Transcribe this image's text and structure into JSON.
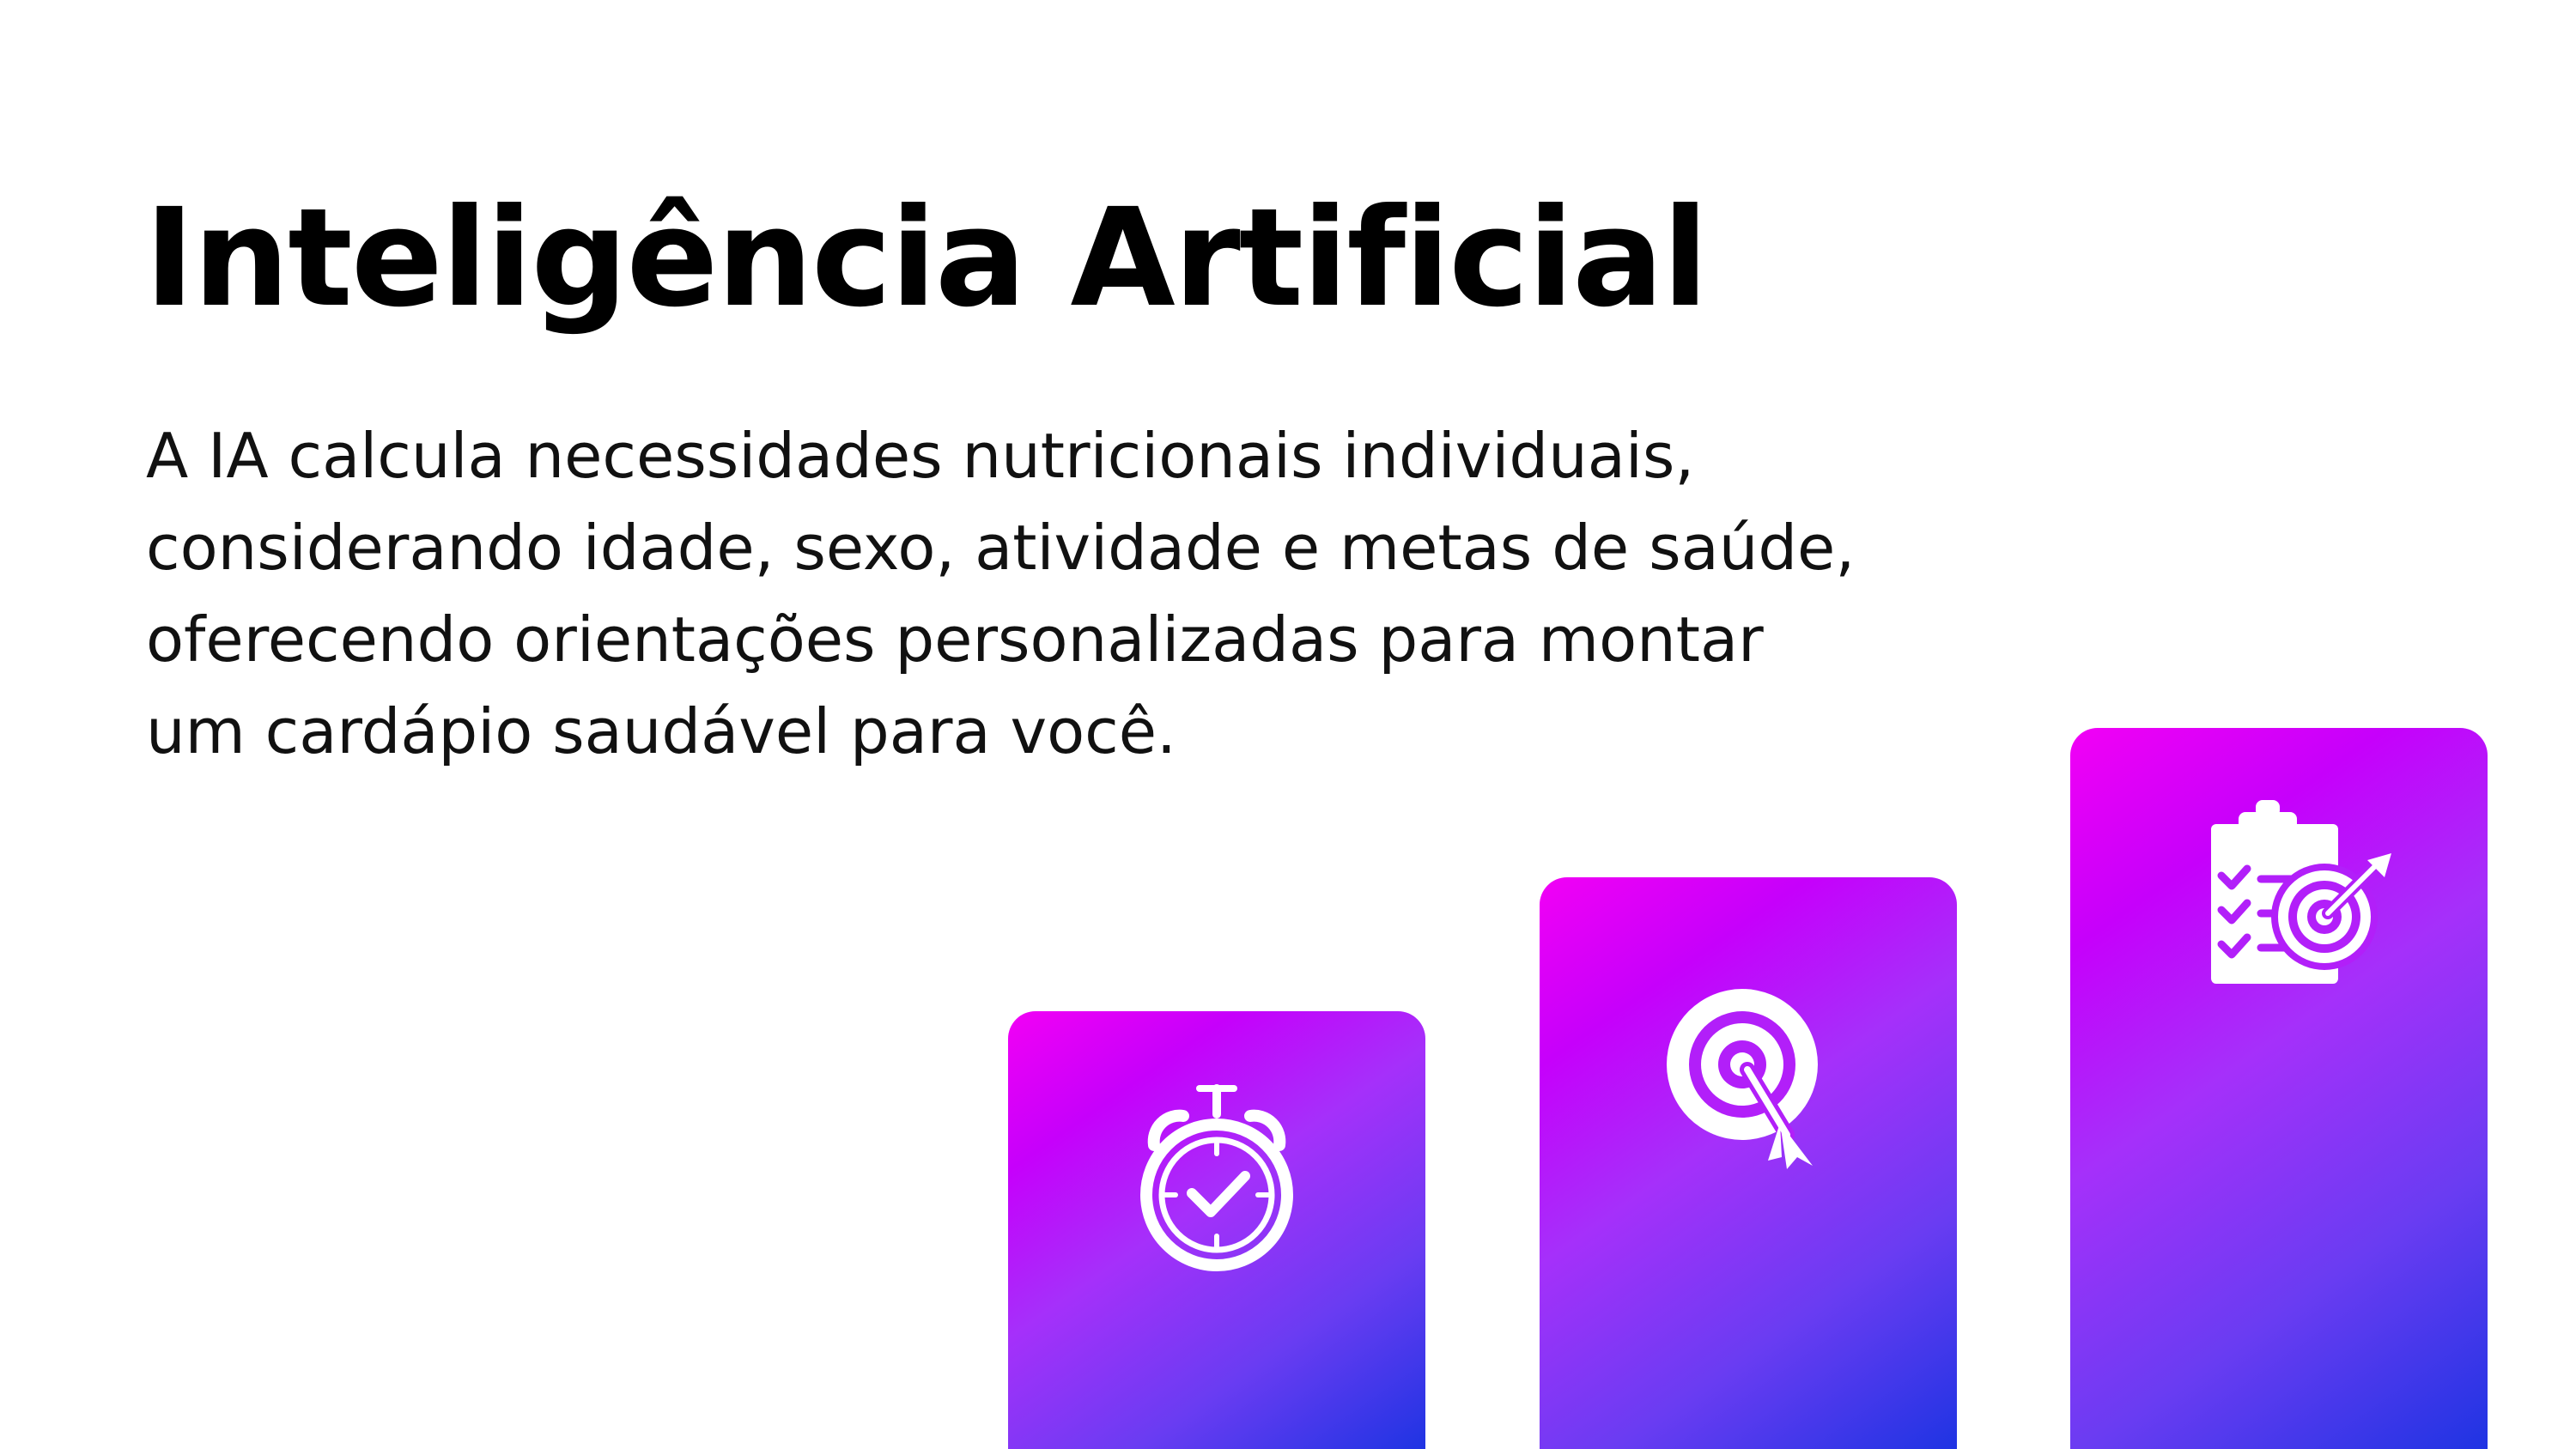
{
  "slide": {
    "title": "Inteligência Artificial",
    "body_lines": [
      "A IA calcula necessidades nutricionais individuais,",
      "considerando idade, sexo, atividade e metas de saúde,",
      "oferecendo orientações personalizadas para montar",
      "um cardápio saudável para você."
    ]
  },
  "cards": [
    {
      "icon": "stopwatch-check-icon"
    },
    {
      "icon": "target-arrow-icon"
    },
    {
      "icon": "clipboard-target-icon"
    }
  ],
  "colors": {
    "gradient_start": "#f200f5",
    "gradient_mid": "#a530fa",
    "gradient_end": "#1f34e3",
    "text": "#000000",
    "background": "#ffffff",
    "icon": "#ffffff"
  }
}
